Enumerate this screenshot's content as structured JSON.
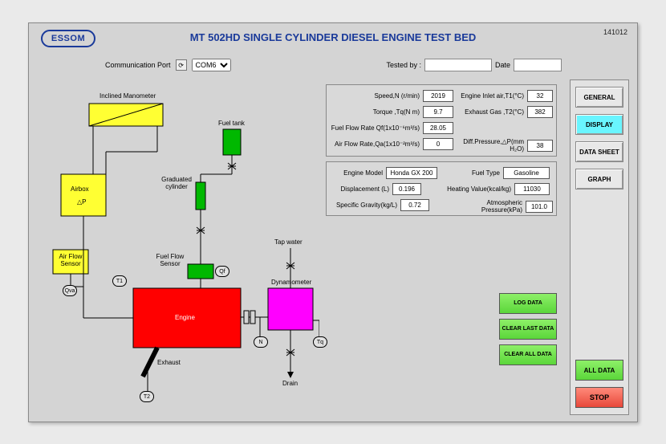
{
  "header": {
    "logo": "ESSOM",
    "title": "MT 502HD SINGLE CYLINDER DIESEL ENGINE TEST BED",
    "doc_no": "141012"
  },
  "commport": {
    "label": "Communication Port",
    "value": "COM6"
  },
  "tested": {
    "by_label": "Tested by :",
    "date_label": "Date"
  },
  "ctrl": {
    "general": "GENERAL",
    "display": "DISPLAY",
    "datasheet": "DATA SHEET",
    "graph": "GRAPH",
    "alldata": "ALL DATA",
    "stop": "STOP"
  },
  "greenbtns": {
    "log": "LOG DATA",
    "clearlast": "CLEAR LAST DATA",
    "clearall": "CLEAR ALL DATA"
  },
  "panelA": {
    "speed_lbl": "Speed,N (r/min)",
    "speed": "2019",
    "torque_lbl": "Torque ,Tq(N m)",
    "torque": "9.7",
    "fuelflow_lbl": "Fuel Flow Rate Qf(1x10⁻⁶m³/s)",
    "fuelflow": "28.05",
    "airflow_lbl": "Air Flow Rate,Qa(1x10⁻²m³/s)",
    "airflow": "0",
    "inlet_lbl": "Engine Inlet air,T1(°C)",
    "inlet": "32",
    "exhaust_lbl": "Exhaust Gas ,T2(°C)",
    "exhaust": "382",
    "diffp_lbl": "Diff.Pressure,△P(mm H₂O)",
    "diffp": "38"
  },
  "panelB": {
    "model_lbl": "Engine Model",
    "model": "Honda GX 200",
    "disp_lbl": "Displacement (L)",
    "disp": "0.196",
    "sg_lbl": "Specific Gravity(kg/L)",
    "sg": "0.72",
    "fuel_lbl": "Fuel Type",
    "fuel": "Gasoline",
    "hv_lbl": "Heating Value(kcal/kg)",
    "hv": "11030",
    "atm_lbl": "Atmospheric Pressure(kPa)",
    "atm": "101.0"
  },
  "diag": {
    "inclined_manometer": "Inclined Manometer",
    "fuel_tank": "Fuel tank",
    "airbox": "Airbox",
    "dp": "△P",
    "graduated_cylinder": "Graduated cylinder",
    "airflow_sensor": "Air Flow Sensor",
    "fuelflow_sensor": "Fuel Flow Sensor",
    "engine": "Engine",
    "exhaust": "Exhaust",
    "tap_water": "Tap water",
    "dynamometer": "Dynamometer",
    "drain": "Drain",
    "qva": "Qva",
    "t1": "T1",
    "qf": "Qf",
    "n": "N",
    "tq": "Tq",
    "t2": "T2"
  }
}
